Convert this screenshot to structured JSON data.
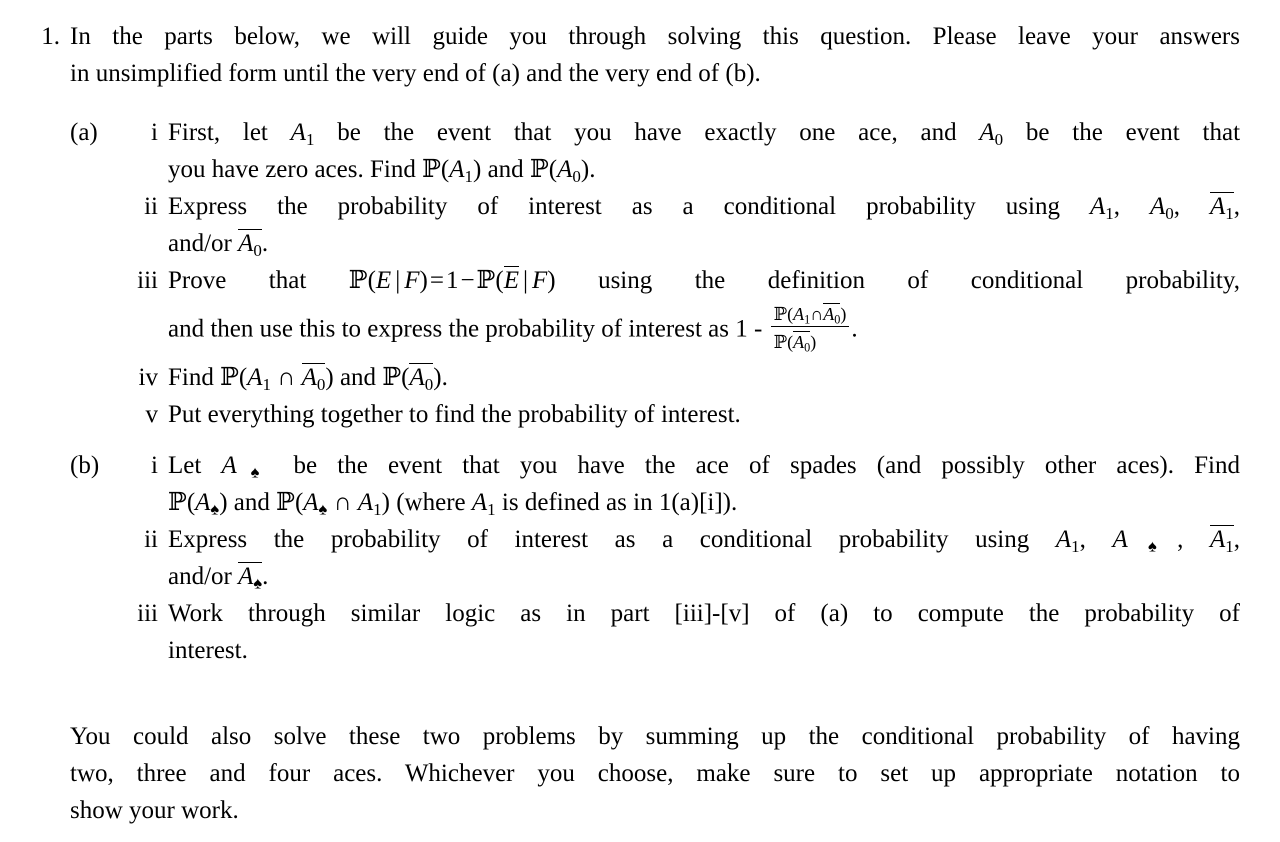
{
  "document": {
    "type": "probability-homework-problem",
    "background_color": "#ffffff",
    "text_color": "#000000"
  },
  "problem": {
    "marker": "1.",
    "intro": {
      "line1": "In the parts below, we will guide you through solving this question. Please leave your answers",
      "line2": "in unsimplified form until the very end of (a) and the very end of (b)."
    },
    "parts": [
      {
        "marker": "(a)",
        "subparts": [
          {
            "marker": "i",
            "line1_a": "First, let",
            "line1_math1": "A",
            "line1_math1_sub": "1",
            "line1_b": "be the event that you have exactly one ace, and",
            "line1_math2": "A",
            "line1_math2_sub": "0",
            "line1_c": "be the event that",
            "line2_a": "you have zero aces. Find",
            "line2_math1": "P(A",
            "line2_math1_sub": "1",
            "line2_b": "and",
            "line2_math2": "P(A",
            "line2_math2_sub": "0",
            "line2_c": ").",
            "plain_text": "First, let A_1 be the event that you have exactly one ace, and A_0 be the event that you have zero aces. Find P(A_1) and P(A_0)."
          },
          {
            "marker": "ii",
            "line1": "Express the probability of interest as a conditional probability using",
            "line2_prefix": "and/or",
            "symbols": [
              "A1",
              "A0",
              "A1-bar",
              "A0-bar"
            ],
            "plain_text": "Express the probability of interest as a conditional probability using A_1, A_0, A_1-bar, and/or A_0-bar."
          },
          {
            "marker": "iii",
            "line1_a": "Prove that",
            "line1_eq": "P(E | F) = 1 - P(E-bar | F)",
            "line1_b": "using the definition of conditional probability,",
            "line2_a": "and then use this to express the probability of interest as 1 -",
            "fraction": {
              "numerator": "P(A1 ∩ A0-bar)",
              "denominator": "P(A0-bar)"
            },
            "line2_end": ".",
            "plain_text": "Prove that P(E | F) = 1 - P(E-bar | F) using the definition of conditional probability, and then use this to express the probability of interest as 1 - P(A_1 and A_0-bar)/P(A_0-bar)."
          },
          {
            "marker": "iv",
            "line1_a": "Find",
            "line1_b": "and",
            "line1_c": ".",
            "plain_text": "Find P(A_1 ∩ A_0-bar) and P(A_0-bar)."
          },
          {
            "marker": "v",
            "line1": "Put everything together to find the probability of interest.",
            "plain_text": "Put everything together to find the probability of interest."
          }
        ]
      },
      {
        "marker": "(b)",
        "subparts": [
          {
            "marker": "i",
            "line1_a": "Let",
            "line1_b": "be the event that you have the ace of spades (and possibly other aces). Find",
            "line2_mid": "and",
            "line2_paren": "(where",
            "line2_end": "is defined as in 1(a)[i]).",
            "plain_text": "Let A_spade be the event that you have the ace of spades (and possibly other aces). Find P(A_spade) and P(A_spade ∩ A_1) (where A_1 is defined as in 1(a)[i])."
          },
          {
            "marker": "ii",
            "line1": "Express the probability of interest as a conditional probability using",
            "line2_prefix": "and/or",
            "symbols": [
              "A1",
              "A-spade",
              "A1-bar",
              "A-spade-bar"
            ],
            "plain_text": "Express the probability of interest as a conditional probability using A_1, A_spade, A_1-bar, and/or A_spade-bar."
          },
          {
            "marker": "iii",
            "line1": "Work through similar logic as in part [iii]-[v] of (a) to compute the probability of",
            "line2": "interest.",
            "reference": "[iii]-[v]",
            "plain_text": "Work through similar logic as in part [iii]-[v] of (a) to compute the probability of interest."
          }
        ]
      }
    ],
    "closing": {
      "line1": "You could also solve these two problems by summing up the conditional probability of having",
      "line2": "two, three and four aces. Whichever you choose, make sure to set up appropriate notation to",
      "line3": "show your work.",
      "plain_text": "You could also solve these two problems by summing up the conditional probability of having two, three and four aces. Whichever you choose, make sure to set up appropriate notation to show your work."
    }
  },
  "symbols": {
    "probability": "ℙ",
    "intersection": "∩",
    "spade": "♠",
    "given": "|",
    "minus": "−",
    "equals": "=",
    "letter_A": "A",
    "letter_E": "E",
    "letter_F": "F",
    "sub_one": "1",
    "sub_zero": "0",
    "one": "1"
  }
}
